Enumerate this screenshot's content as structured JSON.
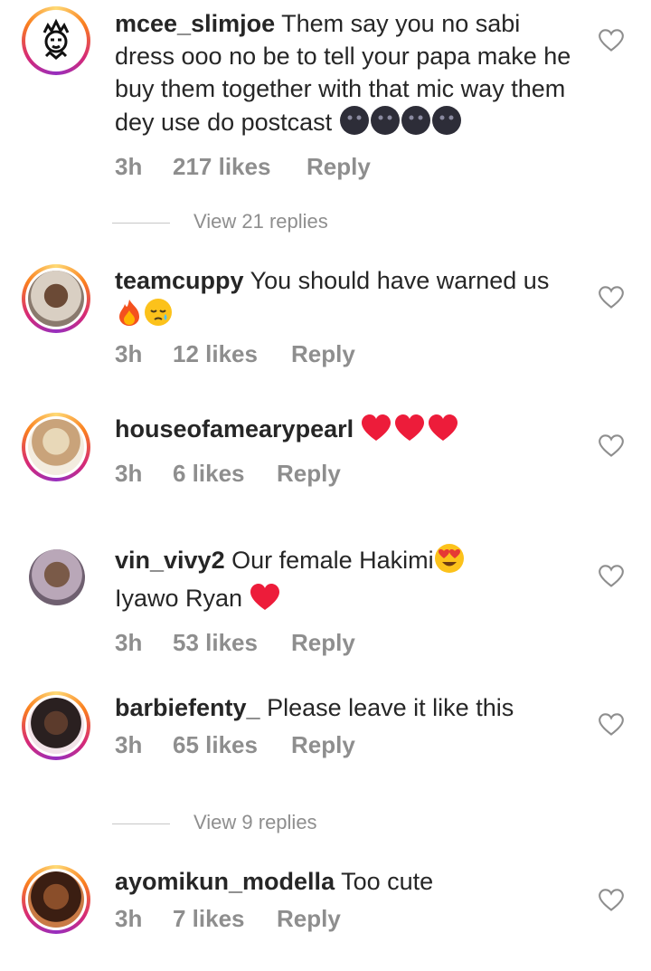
{
  "comments": [
    {
      "username": "mcee_slimjoe",
      "text": "Them say you no sabi dress ooo no be to tell your papa make he buy them together with that mic way them dey use do postcast",
      "time": "3h",
      "likes": "217 likes",
      "reply": "Reply"
    },
    {
      "username": "teamcuppy",
      "text": "You should have warned us",
      "time": "3h",
      "likes": "12 likes",
      "reply": "Reply"
    },
    {
      "username": "houseofamearypearl",
      "text": "",
      "time": "3h",
      "likes": "6 likes",
      "reply": "Reply"
    },
    {
      "username": "vin_vivy2",
      "text": "Our female Hakimi",
      "text2": "Iyawo Ryan",
      "time": "3h",
      "likes": "53 likes",
      "reply": "Reply"
    },
    {
      "username": "barbiefenty_",
      "text": "Please leave it like this",
      "time": "3h",
      "likes": "65 likes",
      "reply": "Reply"
    },
    {
      "username": "ayomikun_modella",
      "text": "Too cute",
      "time": "3h",
      "likes": "7 likes",
      "reply": "Reply"
    }
  ],
  "view_replies": [
    "View 21 replies",
    "View 9 replies"
  ],
  "colors": {
    "muted": "#8e8e8e",
    "text": "#262626",
    "heart_red": "#ed1c3a"
  }
}
